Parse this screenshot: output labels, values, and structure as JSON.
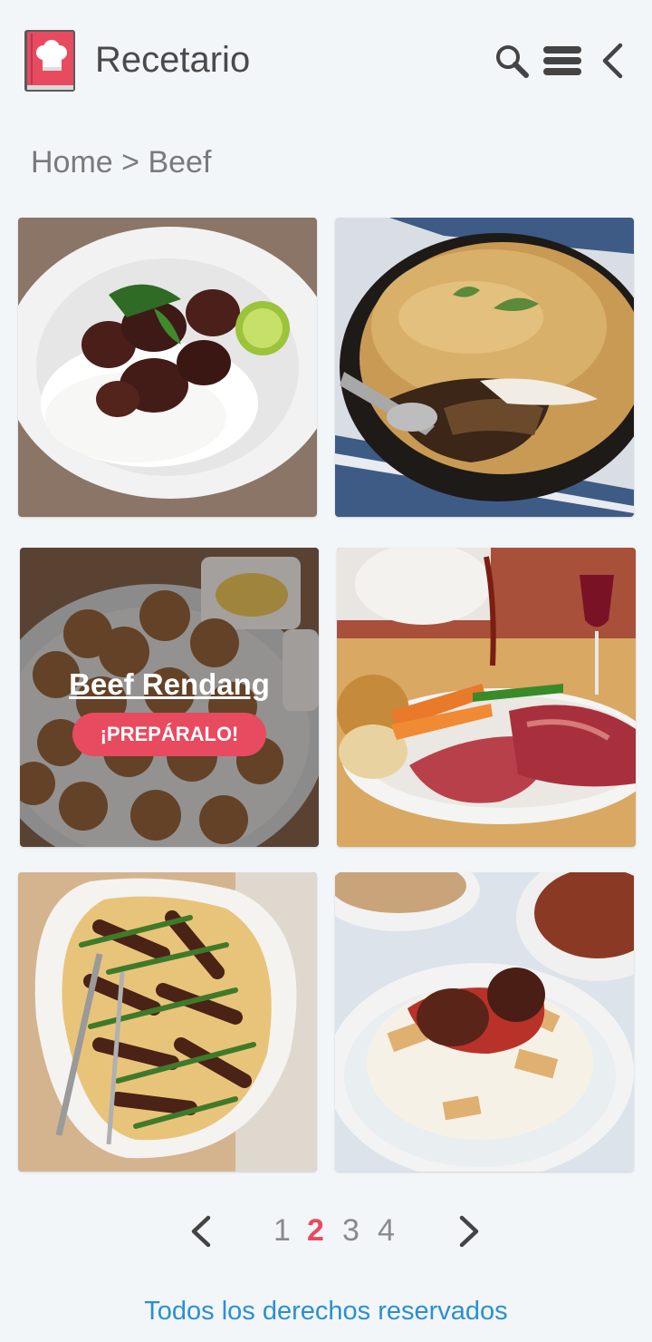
{
  "app": {
    "title": "Recetario"
  },
  "header": {
    "icons": [
      "cookbook-logo-icon",
      "search-icon",
      "menu-icon",
      "back-chevron-icon"
    ]
  },
  "breadcrumb": {
    "text": "Home > Beef"
  },
  "grid": {
    "featured": {
      "title": "Beef Rendang",
      "button": "¡PREPÁRALO!"
    }
  },
  "pagination": {
    "pages": [
      "1",
      "2",
      "3",
      "4"
    ],
    "current": "2"
  },
  "footer": {
    "text": "Todos los derechos reservados"
  },
  "colors": {
    "accent": "#e84a5f",
    "link": "#2a8fd4",
    "background": "#f3f6f9"
  }
}
